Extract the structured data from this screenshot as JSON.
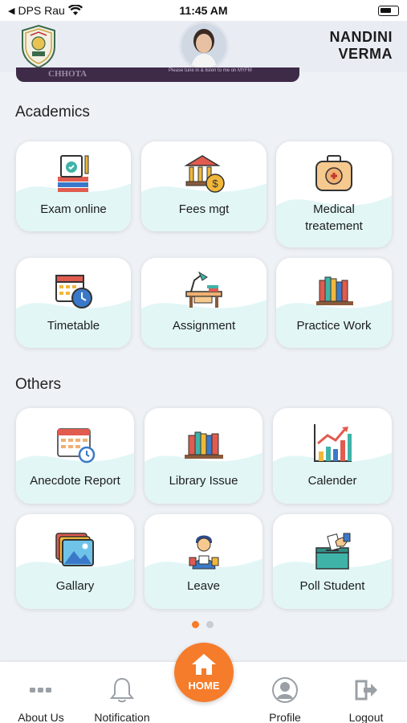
{
  "status_bar": {
    "carrier": "DPS Rau",
    "time": "11:45 AM"
  },
  "header": {
    "user_name_line1": "NANDINI",
    "user_name_line2": "VERMA"
  },
  "banner": {
    "text_main": "CHHOTA",
    "text_small": "Please tune in & listen to me on MYFM"
  },
  "sections": {
    "academics": "Academics",
    "others": "Others"
  },
  "academics": [
    {
      "label": "Exam online",
      "icon": "exam-icon"
    },
    {
      "label": "Fees mgt",
      "icon": "bank-fees-icon"
    },
    {
      "label": "Medical treatement",
      "line1": "Medical",
      "line2": "treatement",
      "icon": "medical-kit-icon"
    },
    {
      "label": "Timetable",
      "icon": "calendar-clock-icon"
    },
    {
      "label": "Assignment",
      "icon": "desk-lamp-icon"
    },
    {
      "label": "Practice Work",
      "icon": "books-icon"
    }
  ],
  "others": [
    {
      "label": "Anecdote Report",
      "icon": "calendar-report-icon"
    },
    {
      "label": "Library Issue",
      "icon": "books-icon"
    },
    {
      "label": "Calender",
      "icon": "chart-icon"
    },
    {
      "label": "Gallary",
      "icon": "gallery-icon"
    },
    {
      "label": "Leave",
      "icon": "student-icon"
    },
    {
      "label": "Poll Student",
      "icon": "ballot-box-icon"
    }
  ],
  "pager": {
    "pages": 2,
    "active": 1
  },
  "tabbar": {
    "about": "About Us",
    "notification": "Notification",
    "home": "HOME",
    "profile": "Profile",
    "logout": "Logout"
  },
  "colors": {
    "accent": "#f57c2b",
    "wave": "#e2f6f6",
    "background": "#eef1f5"
  }
}
